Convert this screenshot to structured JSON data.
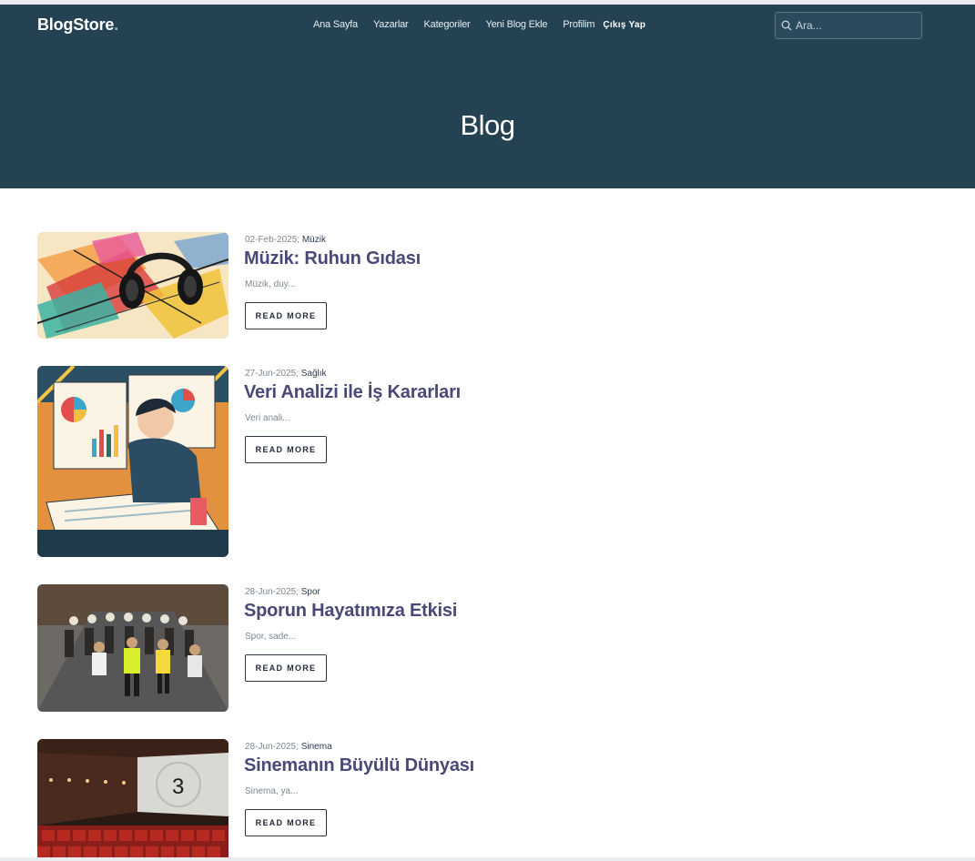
{
  "header": {
    "brand": "BlogStore",
    "brand_dot": ".",
    "nav": [
      "Ana Sayfa",
      "Yazarlar",
      "Kategoriler",
      "Yeni Blog Ekle",
      "Profilim"
    ],
    "logout": "Çıkış Yap",
    "search": {
      "placeholder": "Ara..."
    }
  },
  "hero": {
    "title": "Blog"
  },
  "posts": [
    {
      "date": "02-Feb-2025;",
      "category": "Müzik",
      "title": "Müzik: Ruhun Gıdası",
      "excerpt": "Müzik, duy...",
      "button": "READ MORE",
      "image": "abstract-headphones-art"
    },
    {
      "date": "27-Jun-2025;",
      "category": "Sağlık",
      "title": "Veri Analizi ile İş Kararları",
      "excerpt": "Veri anali...",
      "button": "READ MORE",
      "image": "data-analysis-illustration"
    },
    {
      "date": "28-Jun-2025;",
      "category": "Spor",
      "title": "Sporun Hayatımıza Etkisi",
      "excerpt": "Spor, sade...",
      "button": "READ MORE",
      "image": "marathon-runners-photo"
    },
    {
      "date": "28-Jun-2025;",
      "category": "Sinema",
      "title": "Sinemanın Büyülü Dünyası",
      "excerpt": "Sinema, ya...",
      "button": "READ MORE",
      "image": "cinema-hall-photo"
    }
  ]
}
